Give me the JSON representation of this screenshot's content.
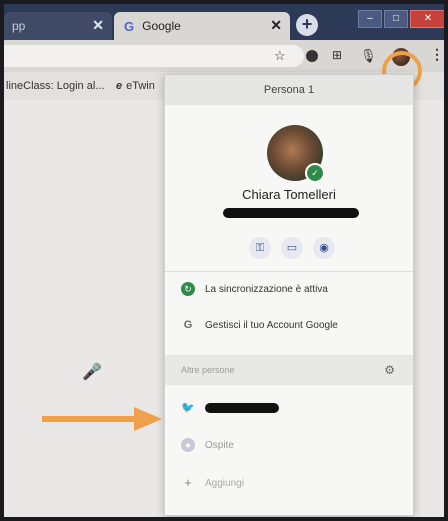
{
  "browser": {
    "tabs": [
      {
        "title": "pp",
        "active": false
      },
      {
        "title": "Google",
        "active": true
      }
    ],
    "tab_close_glyph": "✕",
    "new_tab_glyph": "+"
  },
  "bookmarks": [
    {
      "label": "lineClass: Login al..."
    },
    {
      "icon_text": "e",
      "label": "eTwin"
    }
  ],
  "menu": {
    "header": "Persona 1",
    "profile_name": "Chiara Tomelleri",
    "quick_icons": [
      "key-icon",
      "card-icon",
      "location-pin-icon"
    ],
    "sync_text": "La sincronizzazione è attiva",
    "manage_account_text": "Gestisci il tuo Account Google",
    "other_people_label": "Altre persone",
    "guest_label": "Ospite",
    "add_label": "Aggiungi"
  },
  "colors": {
    "tab_strip": "#2c3a58",
    "toolbar": "#d9d7d3",
    "highlight_orange": "#f0a04a",
    "sync_green": "#2e8a4b",
    "close_red": "#c6413b"
  }
}
